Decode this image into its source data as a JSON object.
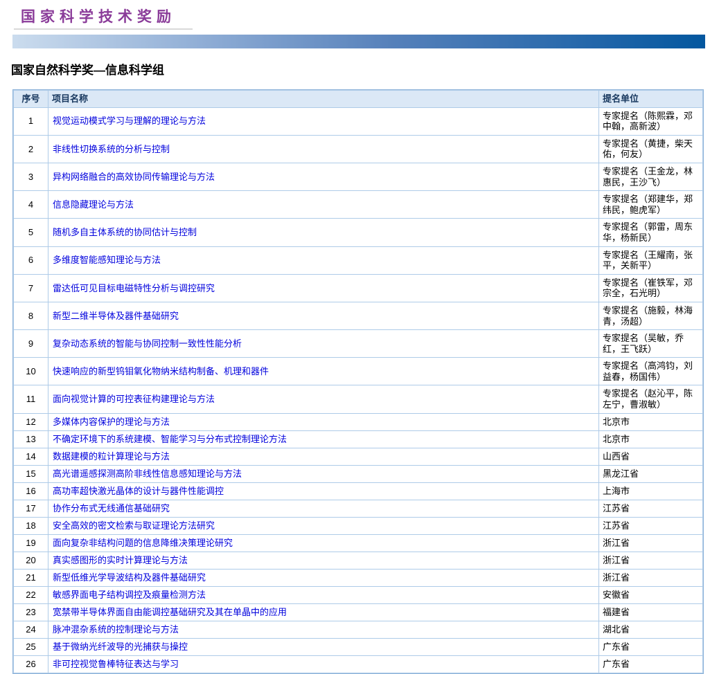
{
  "page": {
    "logo": "国家科学技术奖励",
    "section_title": "国家自然科学奖—信息科学组"
  },
  "colors": {
    "logo_purple": "#8a3b99",
    "bar_gradient_start": "#cbdcee",
    "bar_gradient_end": "#03579f",
    "table_header_bg": "#dbe8f6",
    "table_header_text": "#17375e",
    "table_border_outer": "#8fb4da",
    "table_border_inner": "#aecbe8",
    "link_blue": "#0000dd"
  },
  "table": {
    "columns": [
      "序号",
      "项目名称",
      "提名单位"
    ],
    "rows": [
      {
        "no": "1",
        "title": "视觉运动模式学习与理解的理论与方法",
        "nominator": "专家提名（陈熙霖，邓中翰，高新波）"
      },
      {
        "no": "2",
        "title": "非线性切换系统的分析与控制",
        "nominator": "专家提名（黄捷，柴天佑，何友）"
      },
      {
        "no": "3",
        "title": "异构网络融合的高效协同传输理论与方法",
        "nominator": "专家提名（王金龙，林惠民，王沙飞）"
      },
      {
        "no": "4",
        "title": "信息隐藏理论与方法",
        "nominator": "专家提名（郑建华，郑纬民，鲍虎军）"
      },
      {
        "no": "5",
        "title": "随机多自主体系统的协同估计与控制",
        "nominator": "专家提名（郭雷，周东华，杨新民）"
      },
      {
        "no": "6",
        "title": "多维度智能感知理论与方法",
        "nominator": "专家提名（王耀南，张平，关新平）"
      },
      {
        "no": "7",
        "title": "雷达低可见目标电磁特性分析与调控研究",
        "nominator": "专家提名（崔铁军，邓宗全，石光明）"
      },
      {
        "no": "8",
        "title": "新型二维半导体及器件基础研究",
        "nominator": "专家提名（施毅，林海青，汤超）"
      },
      {
        "no": "9",
        "title": "复杂动态系统的智能与协同控制一致性性能分析",
        "nominator": "专家提名（吴敏，乔红，王飞跃）"
      },
      {
        "no": "10",
        "title": "快速响应的新型钨钼氧化物纳米结构制备、机理和器件",
        "nominator": "专家提名（高鸿钧，刘益春，杨国伟）"
      },
      {
        "no": "11",
        "title": "面向视觉计算的可控表征构建理论与方法",
        "nominator": "专家提名（赵沁平，陈左宁，曹淑敏）"
      },
      {
        "no": "12",
        "title": "多媒体内容保护的理论与方法",
        "nominator": "北京市"
      },
      {
        "no": "13",
        "title": "不确定环境下的系统建模、智能学习与分布式控制理论方法",
        "nominator": "北京市"
      },
      {
        "no": "14",
        "title": "数据建模的粒计算理论与方法",
        "nominator": "山西省"
      },
      {
        "no": "15",
        "title": "高光谱遥感探测高阶非线性信息感知理论与方法",
        "nominator": "黑龙江省"
      },
      {
        "no": "16",
        "title": "高功率超快激光晶体的设计与器件性能调控",
        "nominator": "上海市"
      },
      {
        "no": "17",
        "title": "协作分布式无线通信基础研究",
        "nominator": "江苏省"
      },
      {
        "no": "18",
        "title": "安全高效的密文检索与取证理论方法研究",
        "nominator": "江苏省"
      },
      {
        "no": "19",
        "title": "面向复杂非结构问题的信息降维决策理论研究",
        "nominator": "浙江省"
      },
      {
        "no": "20",
        "title": "真实感图形的实时计算理论与方法",
        "nominator": "浙江省"
      },
      {
        "no": "21",
        "title": "新型低维光学导波结构及器件基础研究",
        "nominator": "浙江省"
      },
      {
        "no": "22",
        "title": "敏感界面电子结构调控及痕量检测方法",
        "nominator": "安徽省"
      },
      {
        "no": "23",
        "title": "宽禁带半导体界面自由能调控基础研究及其在单晶中的应用",
        "nominator": "福建省"
      },
      {
        "no": "24",
        "title": "脉冲混杂系统的控制理论与方法",
        "nominator": "湖北省"
      },
      {
        "no": "25",
        "title": "基于微纳光纤波导的光捕获与操控",
        "nominator": "广东省"
      },
      {
        "no": "26",
        "title": "非可控视觉鲁棒特征表达与学习",
        "nominator": "广东省"
      }
    ]
  }
}
